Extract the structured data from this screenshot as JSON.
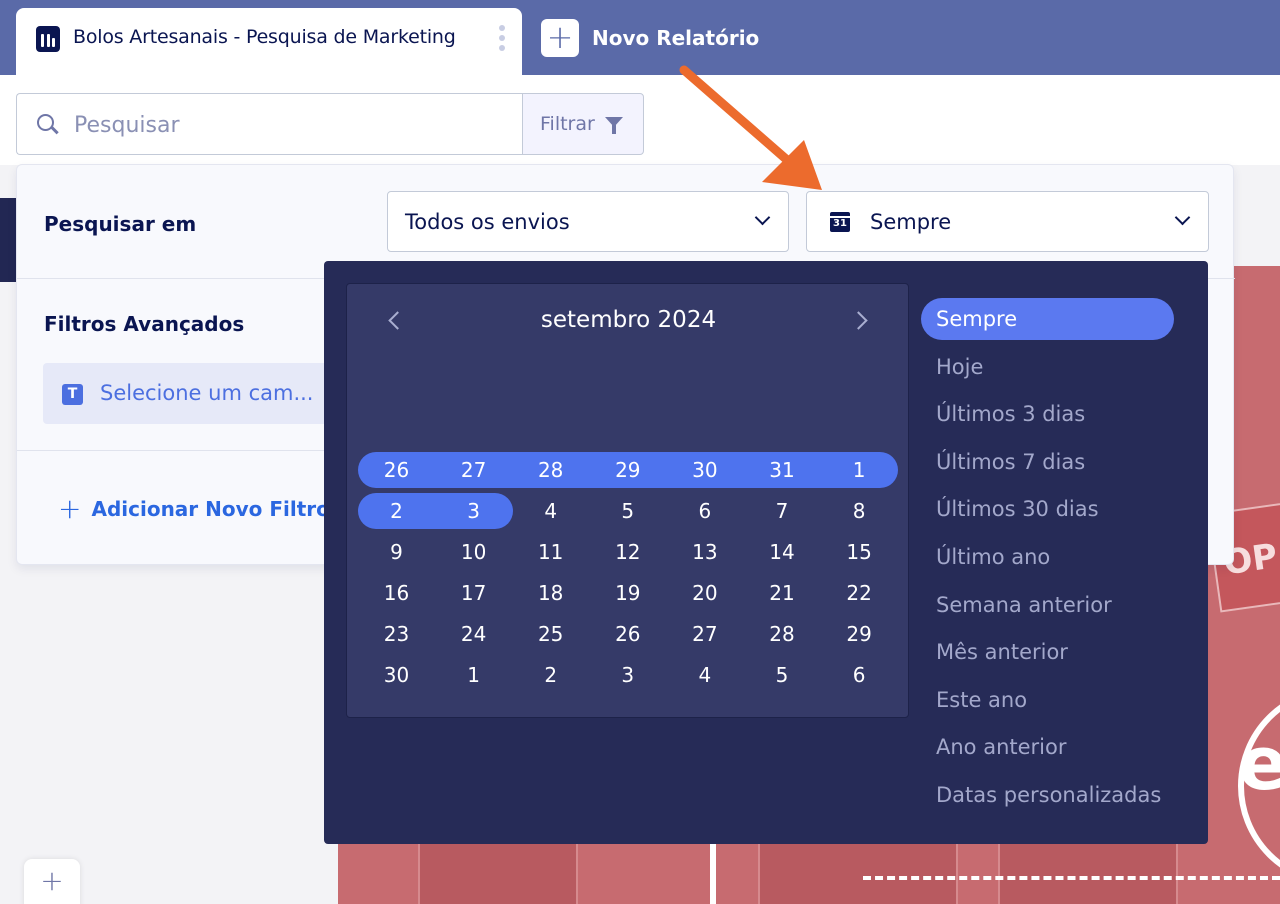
{
  "tabs": {
    "active": {
      "title": "Bolos Artesanais - Pesquisa de Marketing",
      "icon": "report-icon"
    },
    "new": {
      "label": "Novo Relatório",
      "icon": "plus-icon"
    }
  },
  "search": {
    "placeholder": "Pesquisar",
    "filter_label": "Filtrar"
  },
  "filter_panel": {
    "search_in_label": "Pesquisar em",
    "submissions_value": "Todos os envios",
    "date_value": "Sempre",
    "advanced_label": "Filtros Avançados",
    "field_placeholder": "Selecione um cam...",
    "field_type_letter": "T",
    "add_filter_label": "Adicionar Novo Filtro"
  },
  "date_picker": {
    "month_title": "setembro 2024",
    "weeks": [
      [
        "26",
        "27",
        "28",
        "29",
        "30",
        "31",
        "1"
      ],
      [
        "2",
        "3",
        "4",
        "5",
        "6",
        "7",
        "8"
      ],
      [
        "9",
        "10",
        "11",
        "12",
        "13",
        "14",
        "15"
      ],
      [
        "16",
        "17",
        "18",
        "19",
        "20",
        "21",
        "22"
      ],
      [
        "23",
        "24",
        "25",
        "26",
        "27",
        "28",
        "29"
      ],
      [
        "30",
        "1",
        "2",
        "3",
        "4",
        "5",
        "6"
      ]
    ],
    "presets": [
      "Sempre",
      "Hoje",
      "Últimos 3 dias",
      "Últimos 7 dias",
      "Últimos 30 dias",
      "Último ano",
      "Semana anterior",
      "Mês anterior",
      "Este ano",
      "Ano anterior",
      "Datas personalizadas"
    ],
    "active_preset": "Sempre"
  },
  "background": {
    "sign_text": "OP",
    "big_text": "esa"
  },
  "colors": {
    "tab_bar": "#5a6aa8",
    "picker_bg": "#262b57",
    "selection": "#4e73ee",
    "active_preset": "#5b79f0",
    "arrow": "#ec6b2d"
  }
}
